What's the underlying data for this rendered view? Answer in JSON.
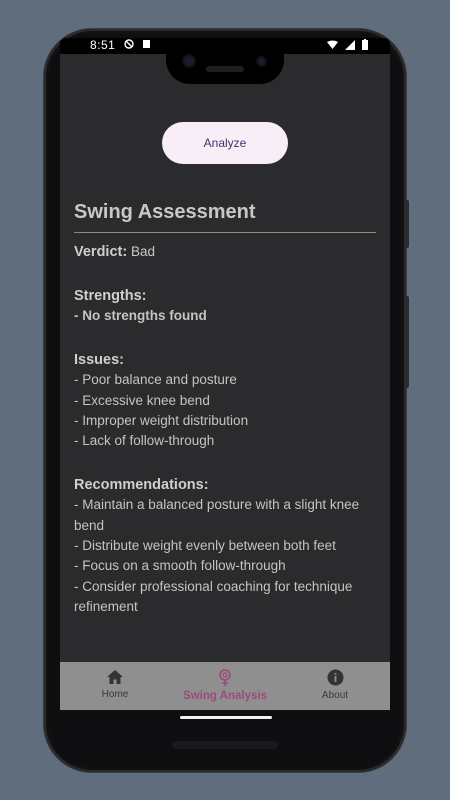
{
  "statusbar": {
    "time": "8:51"
  },
  "analyze_button": {
    "label": "Analyze"
  },
  "assessment": {
    "title": "Swing Assessment",
    "verdict_label": "Verdict:",
    "verdict_value": "Bad",
    "strengths_heading": "Strengths:",
    "strengths": [
      "- No strengths found"
    ],
    "issues_heading": "Issues:",
    "issues": [
      "- Poor balance and posture",
      "- Excessive knee bend",
      "- Improper weight distribution",
      "- Lack of follow-through"
    ],
    "recommendations_heading": "Recommendations:",
    "recommendations": [
      "- Maintain a balanced posture with a slight knee",
      "bend",
      "- Distribute weight evenly between both feet",
      "- Focus on a smooth follow-through",
      "- Consider professional coaching for technique",
      "refinement"
    ]
  },
  "bottom_nav": {
    "items": [
      {
        "label": "Home",
        "icon": "home-icon",
        "active": false
      },
      {
        "label": "Swing Analysis",
        "icon": "swing-analysis-icon",
        "active": true
      },
      {
        "label": "About",
        "icon": "info-icon",
        "active": false
      }
    ]
  },
  "colors": {
    "background": "#2b2a2d",
    "nav_background": "#8f8f8f",
    "active_nav": "#9c4a79",
    "button_bg": "#f8eef8",
    "button_text": "#4b2d6b"
  }
}
